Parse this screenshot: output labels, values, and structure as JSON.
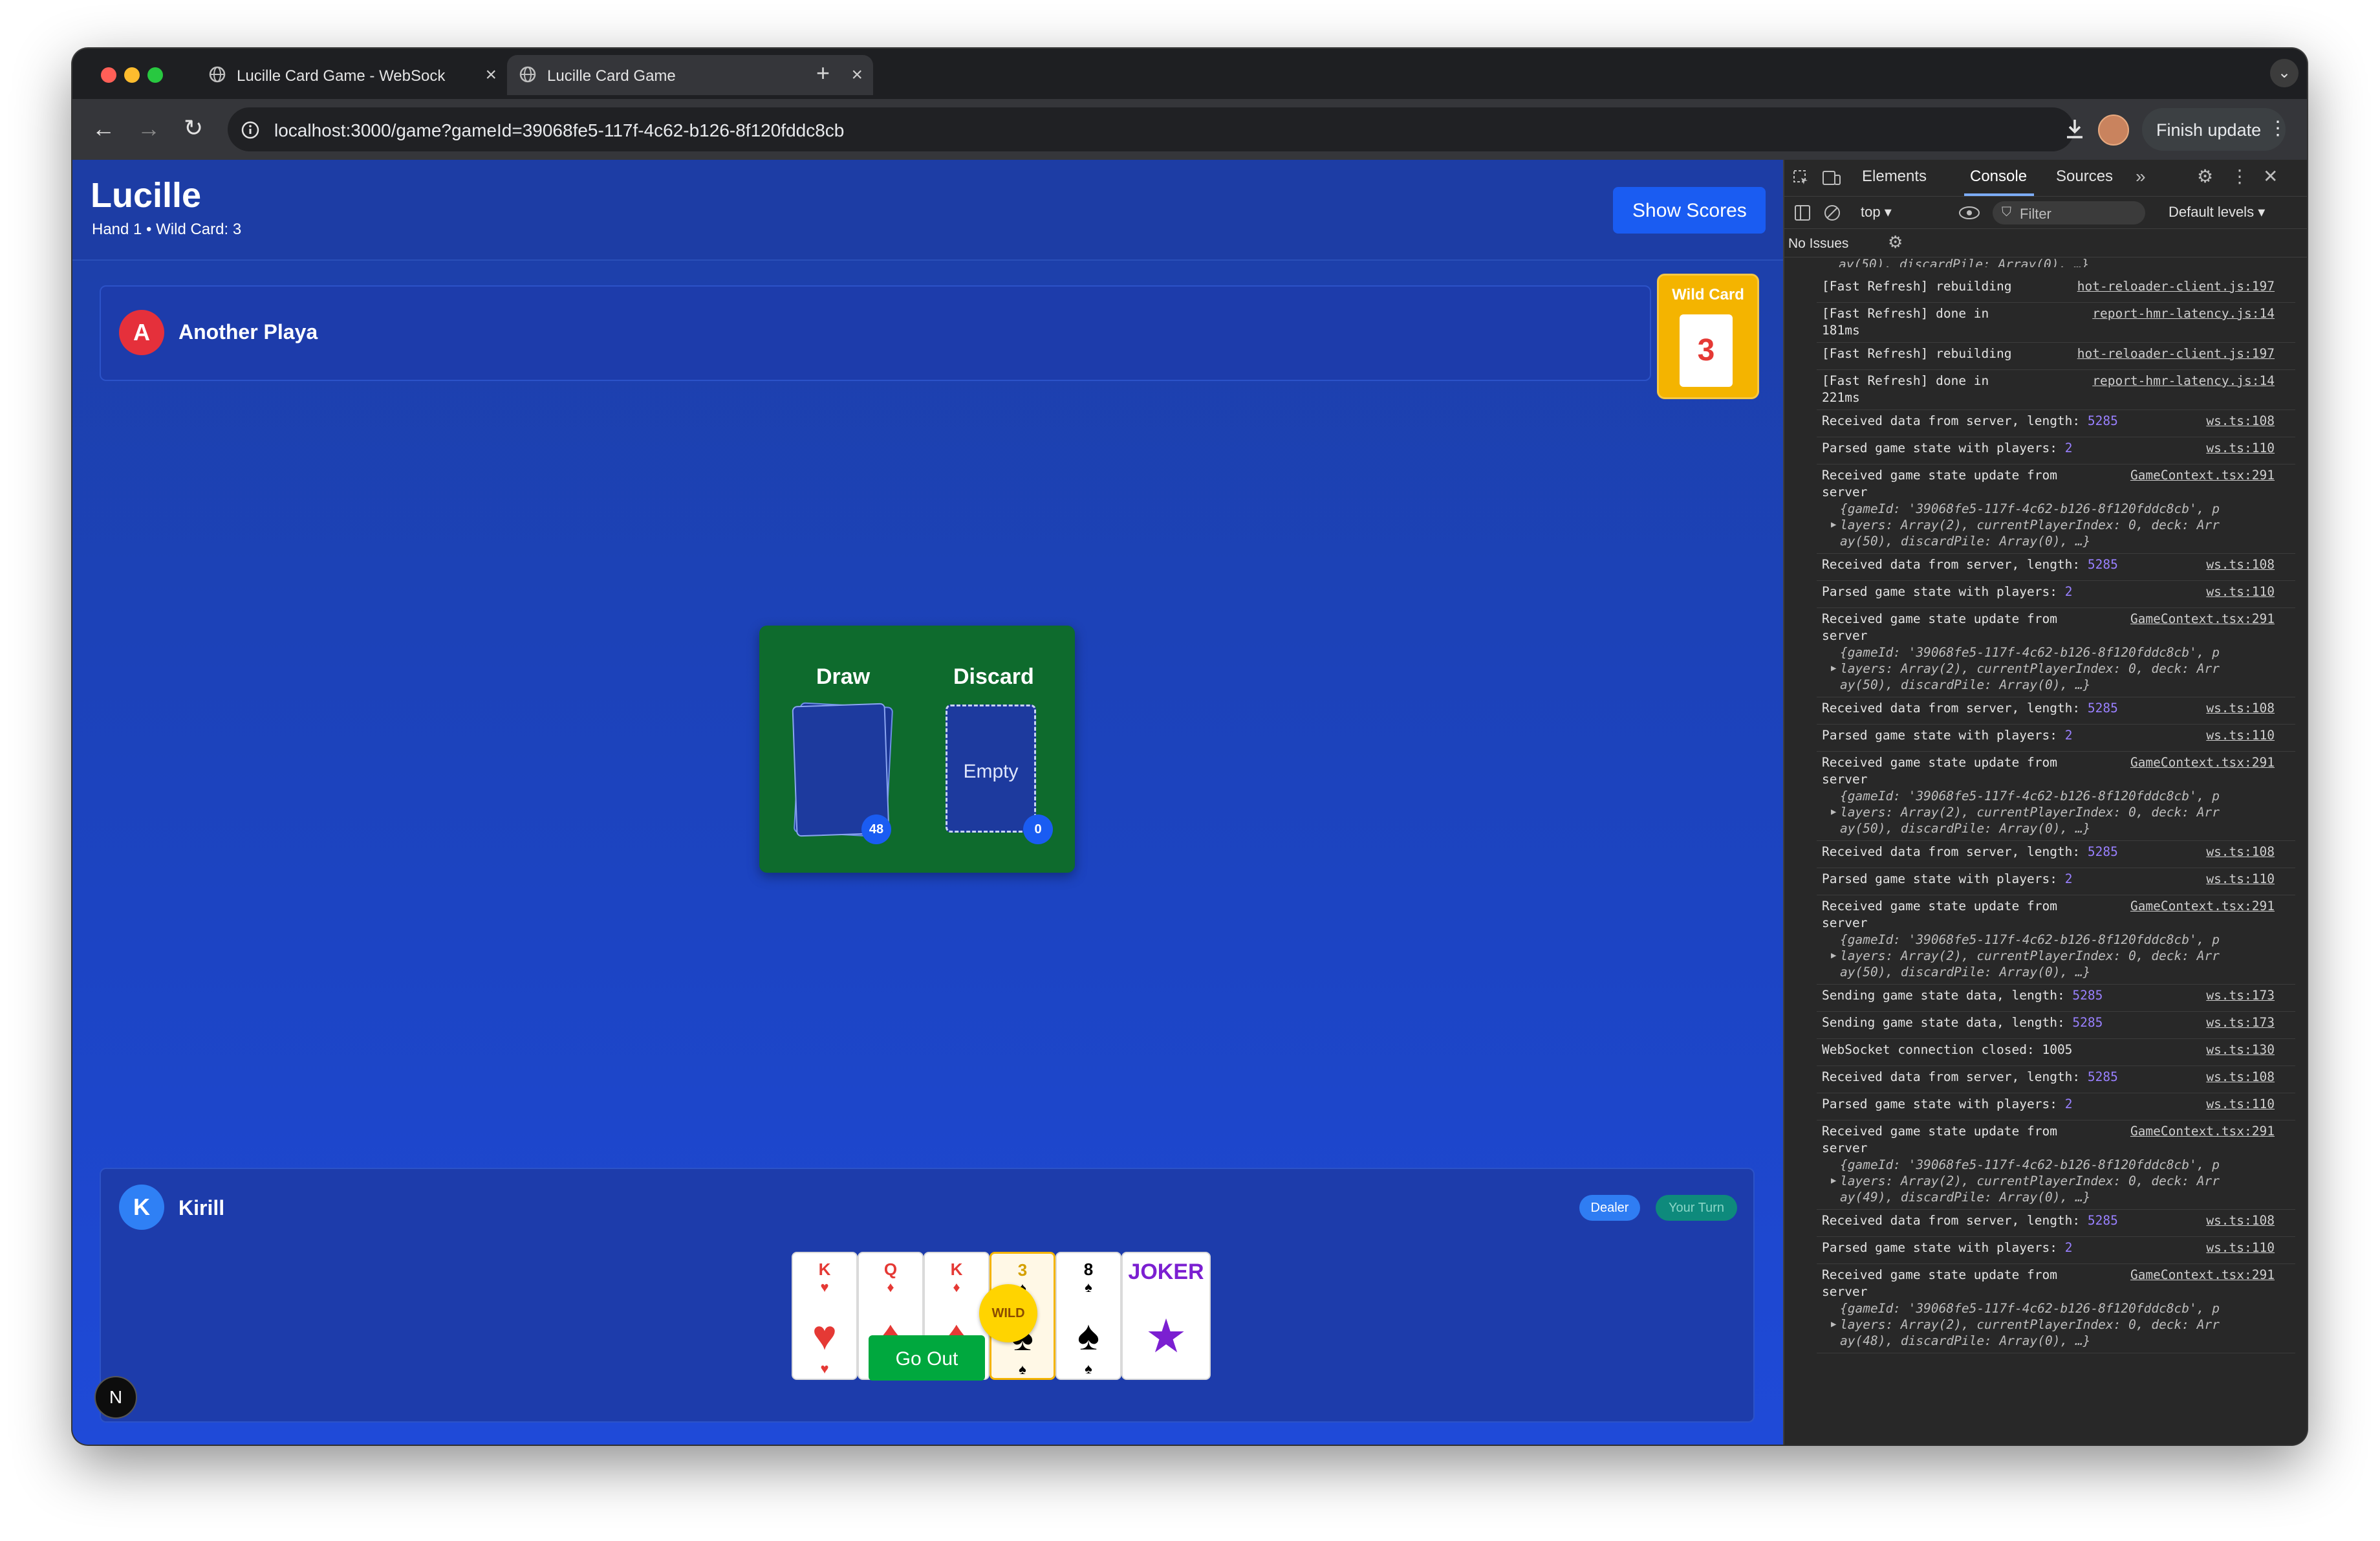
{
  "browser": {
    "tabs": [
      {
        "title": "Lucille Card Game - WebSock"
      },
      {
        "title": "Lucille Card Game"
      }
    ],
    "url": "localhost:3000/game?gameId=39068fe5-117f-4c62-b126-8f120fddc8cb",
    "finish_update_label": "Finish update"
  },
  "game": {
    "title": "Lucille",
    "subtitle": "Hand 1 • Wild Card: 3",
    "show_scores_label": "Show Scores",
    "wild_card": {
      "label": "Wild Card",
      "value": "3"
    },
    "opponent": {
      "initial": "A",
      "name": "Another Playa"
    },
    "piles": {
      "draw_label": "Draw",
      "discard_label": "Discard",
      "discard_empty": "Empty",
      "draw_count": "48",
      "discard_count": "0"
    },
    "player": {
      "initial": "K",
      "name": "Kirill",
      "dealer_badge": "Dealer",
      "turn_badge": "Your Turn",
      "hand": [
        {
          "rank": "K",
          "suit": "♥",
          "color": "#e53935"
        },
        {
          "rank": "Q",
          "suit": "♦",
          "color": "#e53935"
        },
        {
          "rank": "K",
          "suit": "♦",
          "color": "#e53935"
        },
        {
          "rank": "3",
          "suit": "♠",
          "color": "#000000",
          "wild": true
        },
        {
          "rank": "8",
          "suit": "♠",
          "color": "#000000"
        },
        {
          "rank": "JOKER",
          "suit": "★",
          "color": "#7b1fd1"
        }
      ],
      "wild_marker": "WILD",
      "go_out_label": "Go Out"
    },
    "next_logo": "N"
  },
  "devtools": {
    "tabs": [
      "Elements",
      "Console",
      "Sources"
    ],
    "context": "top",
    "filter_placeholder": "Filter",
    "levels": "Default levels",
    "issues": "No Issues",
    "top_fragment": "ay(50), discardPile: Array(0), …}",
    "logs": [
      {
        "msg": "[Fast Refresh] rebuilding",
        "src": "hot-reloader-client.js:197"
      },
      {
        "msg": "[Fast Refresh] done in",
        "msg2": "181ms",
        "src": "report-hmr-latency.js:14"
      },
      {
        "msg": "[Fast Refresh] rebuilding",
        "src": "hot-reloader-client.js:197"
      },
      {
        "msg": "[Fast Refresh] done in",
        "msg2": "221ms",
        "src": "report-hmr-latency.js:14"
      },
      {
        "msg": "Received data from server, length: ",
        "num": "5285",
        "src": "ws.ts:108"
      },
      {
        "msg": "Parsed game state with players: ",
        "num": "2",
        "src": "ws.ts:110"
      },
      {
        "msg": "Received game state update from",
        "msg2": "server",
        "src": "GameContext.tsx:291",
        "obj": [
          "{gameId: '39068fe5-117f-4c62-b126-8f120fddc8cb', p",
          "layers: Array(2), currentPlayerIndex: 0, deck: Arr",
          "ay(50), discardPile: Array(0), …}"
        ]
      },
      {
        "msg": "Received data from server, length: ",
        "num": "5285",
        "src": "ws.ts:108"
      },
      {
        "msg": "Parsed game state with players: ",
        "num": "2",
        "src": "ws.ts:110"
      },
      {
        "msg": "Received game state update from",
        "msg2": "server",
        "src": "GameContext.tsx:291",
        "obj": [
          "{gameId: '39068fe5-117f-4c62-b126-8f120fddc8cb', p",
          "layers: Array(2), currentPlayerIndex: 0, deck: Arr",
          "ay(50), discardPile: Array(0), …}"
        ]
      },
      {
        "msg": "Received data from server, length: ",
        "num": "5285",
        "src": "ws.ts:108"
      },
      {
        "msg": "Parsed game state with players: ",
        "num": "2",
        "src": "ws.ts:110"
      },
      {
        "msg": "Received game state update from",
        "msg2": "server",
        "src": "GameContext.tsx:291",
        "obj": [
          "{gameId: '39068fe5-117f-4c62-b126-8f120fddc8cb', p",
          "layers: Array(2), currentPlayerIndex: 0, deck: Arr",
          "ay(50), discardPile: Array(0), …}"
        ]
      },
      {
        "msg": "Received data from server, length: ",
        "num": "5285",
        "src": "ws.ts:108"
      },
      {
        "msg": "Parsed game state with players: ",
        "num": "2",
        "src": "ws.ts:110"
      },
      {
        "msg": "Received game state update from",
        "msg2": "server",
        "src": "GameContext.tsx:291",
        "obj": [
          "{gameId: '39068fe5-117f-4c62-b126-8f120fddc8cb', p",
          "layers: Array(2), currentPlayerIndex: 0, deck: Arr",
          "ay(50), discardPile: Array(0), …}"
        ]
      },
      {
        "msg": "Sending game state data, length: ",
        "num": "5285",
        "src": "ws.ts:173"
      },
      {
        "msg": "Sending game state data, length: ",
        "num": "5285",
        "src": "ws.ts:173"
      },
      {
        "msg": "WebSocket connection closed: 1005",
        "src": "ws.ts:130"
      },
      {
        "msg": "Received data from server, length: ",
        "num": "5285",
        "src": "ws.ts:108"
      },
      {
        "msg": "Parsed game state with players: ",
        "num": "2",
        "src": "ws.ts:110"
      },
      {
        "msg": "Received game state update from",
        "msg2": "server",
        "src": "GameContext.tsx:291",
        "obj": [
          "{gameId: '39068fe5-117f-4c62-b126-8f120fddc8cb', p",
          "layers: Array(2), currentPlayerIndex: 0, deck: Arr",
          "ay(49), discardPile: Array(0), …}"
        ]
      },
      {
        "msg": "Received data from server, length: ",
        "num": "5285",
        "src": "ws.ts:108"
      },
      {
        "msg": "Parsed game state with players: ",
        "num": "2",
        "src": "ws.ts:110"
      },
      {
        "msg": "Received game state update from",
        "msg2": "server",
        "src": "GameContext.tsx:291",
        "obj": [
          "{gameId: '39068fe5-117f-4c62-b126-8f120fddc8cb', p",
          "layers: Array(2), currentPlayerIndex: 0, deck: Arr",
          "ay(48), discardPile: Array(0), …}"
        ]
      }
    ]
  }
}
